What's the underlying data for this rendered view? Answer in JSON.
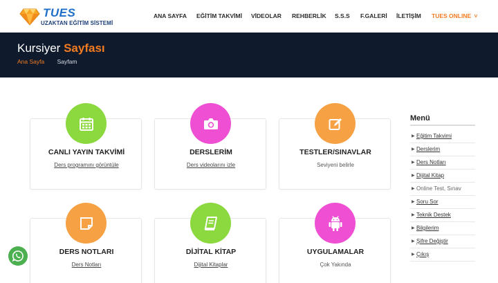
{
  "header": {
    "logo_brand": "TUES",
    "logo_subtitle": "UZAKTAN EĞİTİM SİSTEMİ",
    "nav": [
      {
        "label": "ANA SAYFA"
      },
      {
        "label": "EĞİTİM TAKVİMİ"
      },
      {
        "label": "VİDEOLAR"
      },
      {
        "label": "REHBERLİK"
      },
      {
        "label": "S.S.S"
      },
      {
        "label": "F.GALERİ"
      },
      {
        "label": "İLETİŞİM"
      },
      {
        "label": "TUES ONLINE"
      }
    ],
    "online_chevron": "˅"
  },
  "banner": {
    "title_main": "Kursiyer",
    "title_accent": "Sayfası",
    "crumb_home": "Ana Sayfa",
    "crumb_current": "Sayfam"
  },
  "cards": [
    {
      "title": "CANLI YAYIN TAKVİMİ",
      "link": "Ders programını görüntüle",
      "color": "#8bd83f",
      "icon": "calendar-icon"
    },
    {
      "title": "DERSLERİM",
      "link": "Ders videolarını izle",
      "color": "#ee4fd3",
      "icon": "camera-icon"
    },
    {
      "title": "TESTLER/SINAVLAR",
      "link": "Seviyeni belirle",
      "color": "#f5a144",
      "icon": "edit-icon"
    },
    {
      "title": "DERS NOTLARI",
      "link": "Ders Notları",
      "color": "#f5a144",
      "icon": "note-icon"
    },
    {
      "title": "DİJİTAL KİTAP",
      "link": "Dijital Kitaplar",
      "color": "#8bd83f",
      "icon": "book-icon"
    },
    {
      "title": "UYGULAMALAR",
      "link": "Çok Yakında",
      "color": "#ee4fd3",
      "icon": "android-icon"
    }
  ],
  "menu": {
    "title": "Menü",
    "items": [
      {
        "label": "Eğitim Takvimi"
      },
      {
        "label": "Derslerim"
      },
      {
        "label": "Ders Notları"
      },
      {
        "label": "Dijital Kitap"
      },
      {
        "label": "Online Test, Sınav"
      },
      {
        "label": "Soru Sor"
      },
      {
        "label": "Teknik Destek"
      },
      {
        "label": "Bilgilerim"
      },
      {
        "label": "Şifre Değiştir"
      },
      {
        "label": "Çıkış"
      }
    ]
  },
  "colors": {
    "accent": "#f47b20",
    "banner_bg": "#0f1b2d",
    "brand_blue": "#1f6fc9",
    "whatsapp": "#4caf50"
  },
  "icons": {
    "whatsapp": "whatsapp-icon",
    "logo": "diamond-logo-icon"
  }
}
